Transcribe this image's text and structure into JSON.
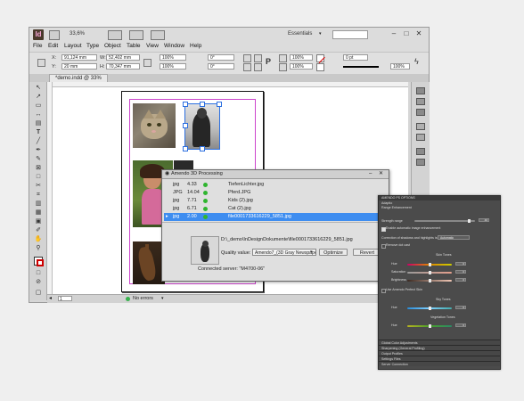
{
  "app": {
    "logo": "Id",
    "zoom": "33,6%",
    "workspace": "Essentials",
    "win_min": "–",
    "win_max": "□",
    "win_close": "✕"
  },
  "menu": [
    "File",
    "Edit",
    "Layout",
    "Type",
    "Object",
    "Table",
    "View",
    "Window",
    "Help"
  ],
  "control": {
    "x_label": "X:",
    "x_value": "91,124 mm",
    "y_label": "Y:",
    "y_value": "20 mm",
    "w_label": "W:",
    "w_value": "52,402 mm",
    "h_label": "H:",
    "h_value": "70,347 mm",
    "scale_x": "100%",
    "scale_y": "100%",
    "angle": "0°",
    "shear": "0°",
    "scale_x2": "100%",
    "scale_y2": "100%",
    "stroke": "0 pt",
    "pct": "100%"
  },
  "document_tab": "*demo.indd @ 33%",
  "status": {
    "page": "1",
    "errors": "No errors"
  },
  "dialog": {
    "title": "Amendo 3D Processing",
    "files": [
      {
        "type": "jpg",
        "size": "4.33",
        "name": "TiefenLichter.jpg",
        "selected": false
      },
      {
        "type": "JPG",
        "size": "14.04",
        "name": "Pferd.JPG",
        "selected": false
      },
      {
        "type": "jpg",
        "size": "7.71",
        "name": "Kids (2).jpg",
        "selected": false
      },
      {
        "type": "jpg",
        "size": "6.71",
        "name": "Cat (2).jpg",
        "selected": false
      },
      {
        "type": "jpg",
        "size": "2.00",
        "name": "file0001733616229_5851.jpg",
        "selected": true
      }
    ],
    "path": "D:\\_demo\\InDesignDokumente\\file0001733616229_5851.jpg",
    "quality_label": "Quality value:",
    "quality_value": "Amendo7_(3D Gray Newspaper Print)",
    "optimize_button": "Optimize",
    "revert_button": "Revert",
    "connected": "Connected server: \"M4700-06\""
  },
  "amendo_panel": {
    "header": "AMENDO PS OPTIONS",
    "sub1": "Adaptio",
    "sub2": "Range Enhancement",
    "strength_label": "Strength range",
    "strength_value": "40",
    "enable_auto": "Enable automatic image enhancement",
    "correction_label": "Correction of shadows and highlights is:",
    "correction_value": "Automatic",
    "remove_cast": "Remove dot cast",
    "skin_title": "Skin Tones",
    "skin_rows": [
      {
        "label": "Hue",
        "value": "0"
      },
      {
        "label": "Saturation",
        "value": "0"
      },
      {
        "label": "Brightness",
        "value": "0"
      }
    ],
    "use_amendo": "Use Amendo Perfect Skin",
    "sky_title": "Sky Tones",
    "sky_rows": [
      {
        "label": "Hue",
        "value": "0"
      }
    ],
    "veg_title": "Vegetation Tones",
    "veg_rows": [
      {
        "label": "Hue",
        "value": "0"
      }
    ],
    "sections": [
      "Global Color Adjustments",
      "Sharpening (General Profiling)",
      "Output Profiles",
      "Settings Files",
      "Server Connection"
    ]
  }
}
